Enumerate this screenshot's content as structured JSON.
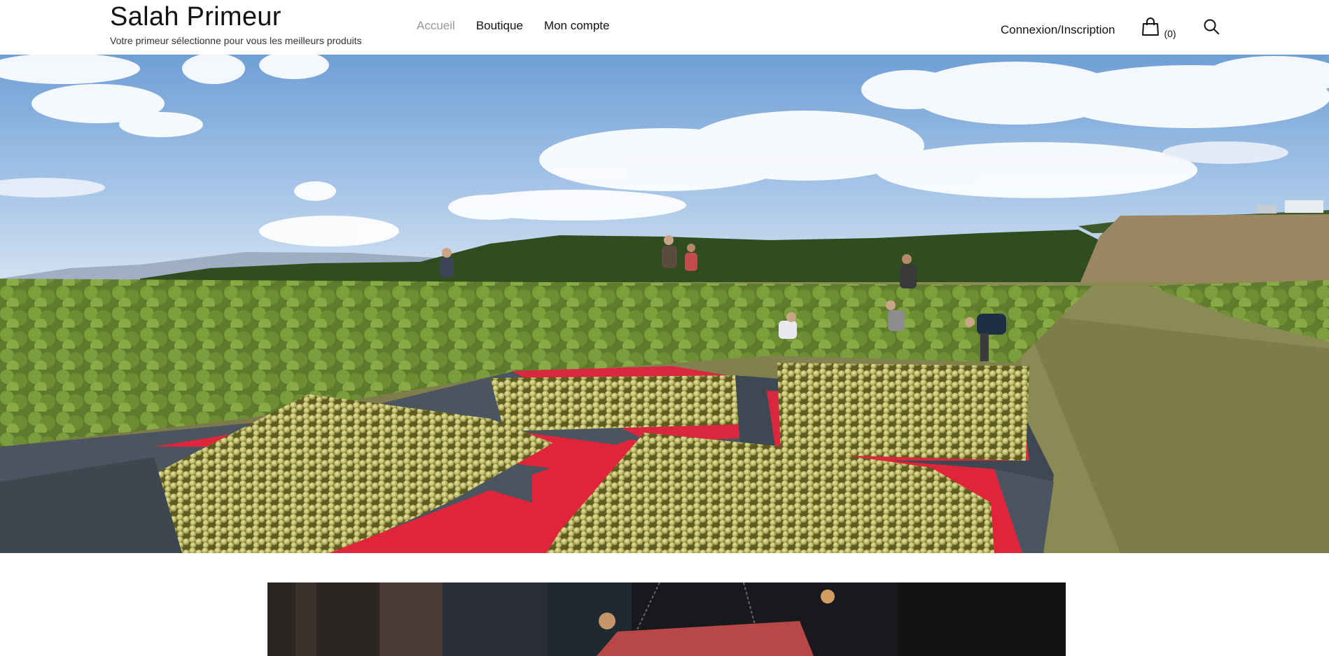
{
  "site": {
    "title": "Salah Primeur",
    "tagline": "Votre primeur sélectionne pour vous les meilleurs produits"
  },
  "nav": {
    "items": [
      {
        "label": "Accueil",
        "active": true
      },
      {
        "label": "Boutique",
        "active": false
      },
      {
        "label": "Mon compte",
        "active": false
      }
    ]
  },
  "account": {
    "login_label": "Connexion/Inscription"
  },
  "cart": {
    "count_label": "(0)",
    "icon": "shopping-bag-icon"
  },
  "search": {
    "icon": "search-icon"
  },
  "hero": {
    "image": "vineyard-grape-harvest-photo"
  },
  "content": {
    "image": "shop-sign-photo"
  },
  "colors": {
    "nav_active": "#999999",
    "text": "#111111",
    "crate_red": "#e0253a",
    "crate_grey": "#4a5560"
  }
}
